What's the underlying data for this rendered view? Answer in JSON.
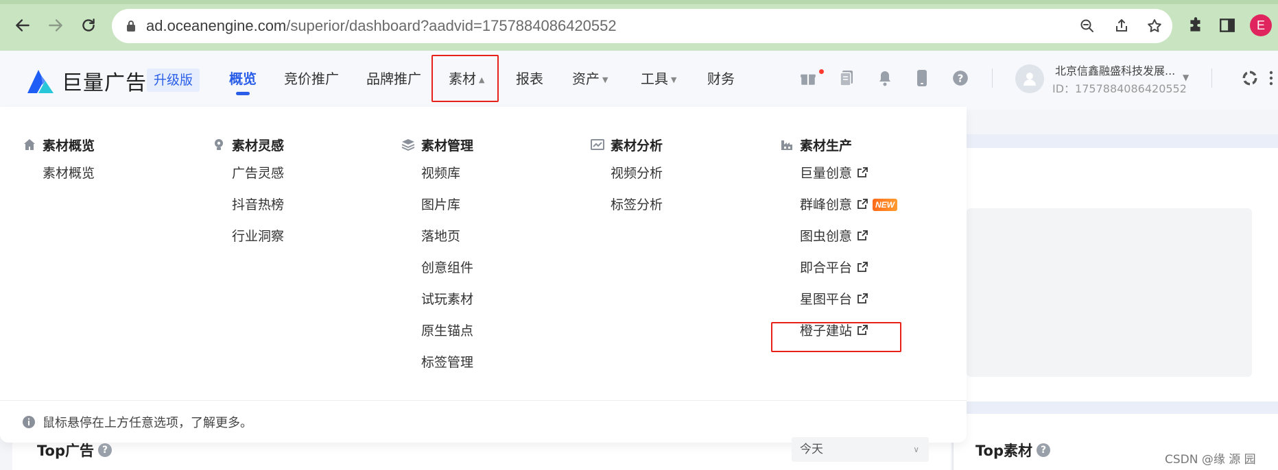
{
  "browser": {
    "url_domain": "ad.oceanengine.com",
    "url_path": "/superior/dashboard?aadvid=1757884086420552",
    "profile_initial": "E"
  },
  "header": {
    "logo_text": "巨量广告",
    "upgrade_label": "升级版",
    "nav": [
      {
        "label": "概览",
        "active": true
      },
      {
        "label": "竞价推广"
      },
      {
        "label": "品牌推广"
      },
      {
        "label": "素材",
        "dropdown": true,
        "open": true
      },
      {
        "label": "报表"
      },
      {
        "label": "资产",
        "dropdown": true
      },
      {
        "label": "工具",
        "dropdown": true
      },
      {
        "label": "财务"
      }
    ],
    "account_name": "北京信鑫融盛科技发展...",
    "account_id": "ID：1757884086420552"
  },
  "dropdown": {
    "columns": [
      {
        "title": "素材概览",
        "icon": "home-icon",
        "items": [
          {
            "label": "素材概览"
          }
        ]
      },
      {
        "title": "素材灵感",
        "icon": "bulb-icon",
        "items": [
          {
            "label": "广告灵感"
          },
          {
            "label": "抖音热榜"
          },
          {
            "label": "行业洞察"
          }
        ]
      },
      {
        "title": "素材管理",
        "icon": "layers-icon",
        "items": [
          {
            "label": "视频库"
          },
          {
            "label": "图片库"
          },
          {
            "label": "落地页"
          },
          {
            "label": "创意组件"
          },
          {
            "label": "试玩素材"
          },
          {
            "label": "原生锚点"
          },
          {
            "label": "标签管理"
          }
        ]
      },
      {
        "title": "素材分析",
        "icon": "chart-icon",
        "items": [
          {
            "label": "视频分析"
          },
          {
            "label": "标签分析"
          }
        ]
      },
      {
        "title": "素材生产",
        "icon": "factory-icon",
        "items": [
          {
            "label": "巨量创意",
            "external": true
          },
          {
            "label": "群峰创意",
            "external": true,
            "badge": "NEW"
          },
          {
            "label": "图虫创意",
            "external": true
          },
          {
            "label": "即合平台",
            "external": true
          },
          {
            "label": "星图平台",
            "external": true
          },
          {
            "label": "橙子建站",
            "external": true
          }
        ]
      }
    ],
    "footer_text": "鼠标悬停在上方任意选项，了解更多。"
  },
  "bottom": {
    "top_ads_title": "Top广告",
    "top_material_title": "Top素材",
    "date_select_value": "今天"
  },
  "watermark": "CSDN @缘  源  园",
  "colors": {
    "accent": "#2a5ee8",
    "highlight": "#e8201a",
    "chrome": "#c9e4c1",
    "new_badge": "#ff7a1f"
  }
}
